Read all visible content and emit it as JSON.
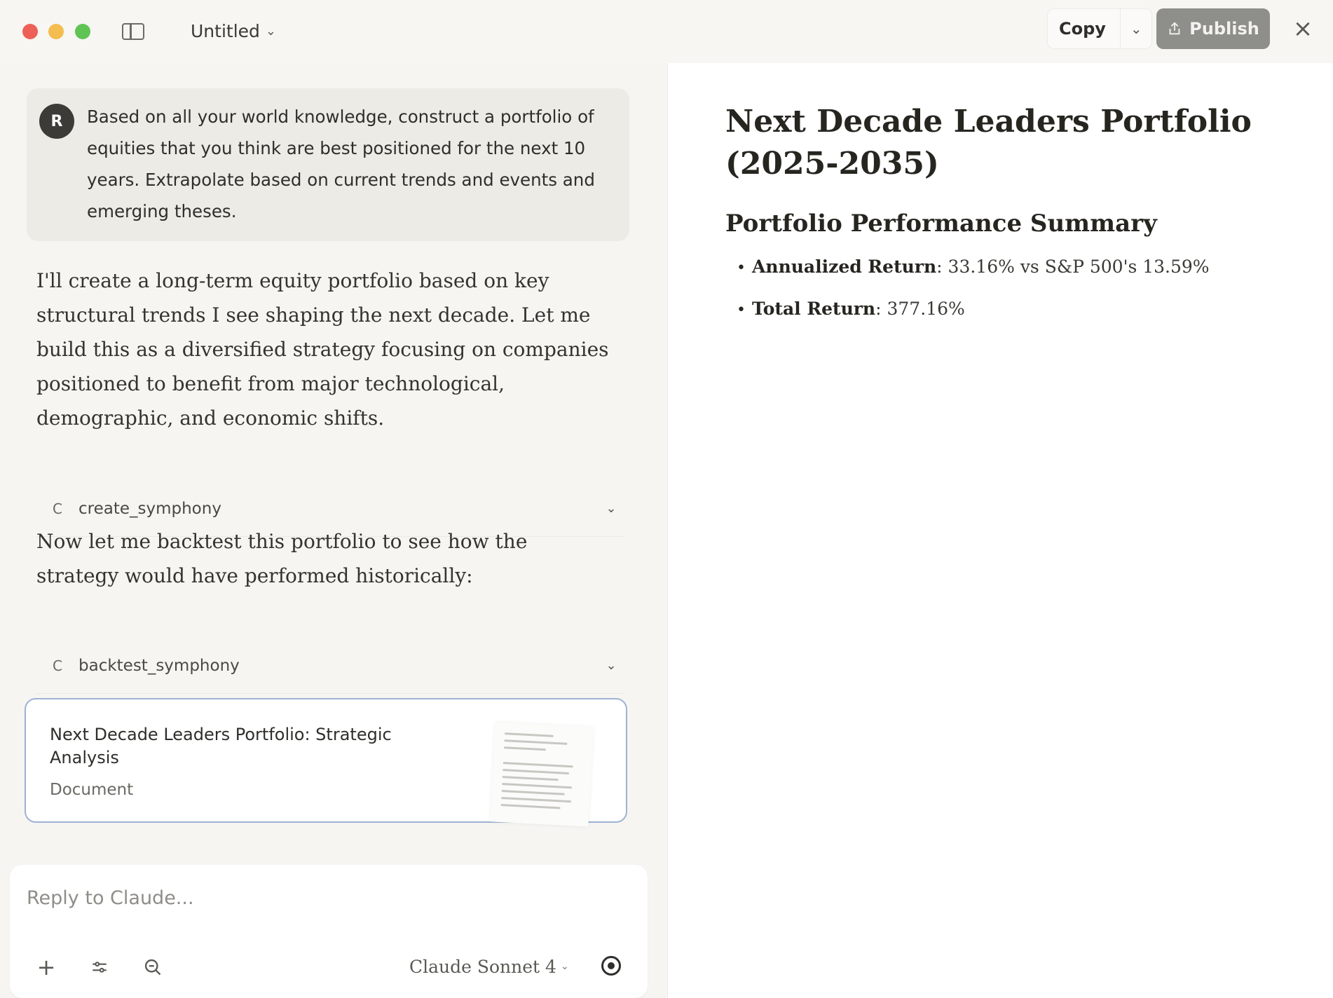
{
  "window": {
    "title": "Untitled"
  },
  "toolbar": {
    "copy_label": "Copy",
    "publish_label": "Publish"
  },
  "chat": {
    "user": {
      "avatar_initial": "R",
      "message": "Based on all your world knowledge, construct a portfolio of equities that you think are best positioned for the next 10 years. Extrapolate based on current trends and events and emerging theses."
    },
    "assistant_paragraph_1": "I'll create a long-term equity portfolio based on key structural trends I see shaping the next decade. Let me build this as a diversified strategy focusing on companies positioned to benefit from major technological, demographic, and economic shifts.",
    "tool_1": {
      "icon": "C",
      "name": "create_symphony"
    },
    "assistant_paragraph_2": "Now let me backtest this portfolio to see how the strategy would have performed historically:",
    "tool_2": {
      "icon": "C",
      "name": "backtest_symphony"
    },
    "artifact": {
      "title": "Next Decade Leaders Portfolio: Strategic Analysis",
      "type": "Document"
    }
  },
  "composer": {
    "placeholder": "Reply to Claude...",
    "model": "Claude Sonnet 4"
  },
  "document": {
    "title": "Next Decade Leaders Portfolio (2025-2035)",
    "section_heading": "Portfolio Performance Summary",
    "items": [
      {
        "label": "Annualized Return",
        "value": ": 33.16% vs S&P 500's 13.59%"
      },
      {
        "label": "Total Return",
        "value": ": 377.16%"
      }
    ]
  },
  "colors": {
    "publish_bg": "#8e8e8b",
    "artifact_border": "#9fb2d3",
    "close_red": "#ee5f57",
    "minimize_yellow": "#f3bd4f",
    "zoom_green": "#5fc454"
  }
}
